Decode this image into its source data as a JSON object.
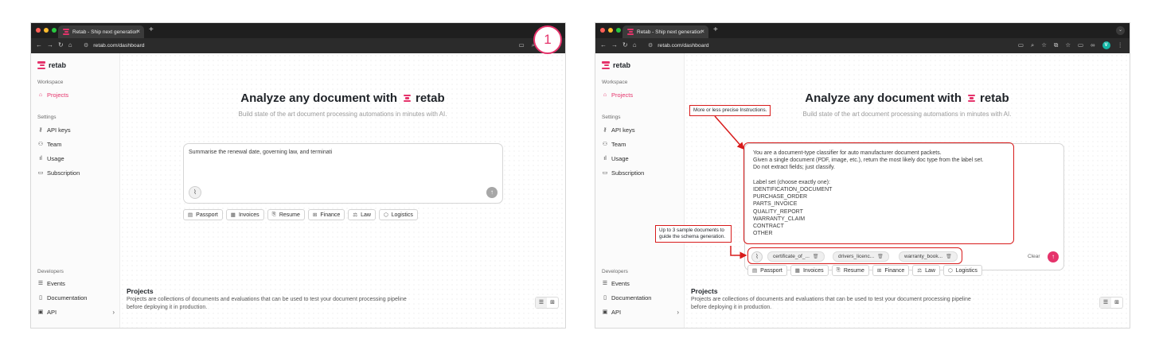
{
  "panels": [
    {
      "browser": {
        "tab_title": "Retab - Ship next generation",
        "tab_close": "×",
        "new_tab": "+",
        "url": "retab.com/dashboard"
      },
      "step_badge": "1",
      "sidebar": {
        "logo": "retab",
        "workspace_title": "Workspace",
        "workspace_items": [
          {
            "label": "Projects",
            "icon": "home-icon"
          }
        ],
        "settings_title": "Settings",
        "settings_items": [
          {
            "label": "API keys",
            "icon": "key-icon"
          },
          {
            "label": "Team",
            "icon": "team-icon"
          },
          {
            "label": "Usage",
            "icon": "bar-chart-icon"
          },
          {
            "label": "Subscription",
            "icon": "credit-card-icon"
          }
        ],
        "developers_title": "Developers",
        "developers_items": [
          {
            "label": "Events",
            "icon": "list-icon"
          },
          {
            "label": "Documentation",
            "icon": "book-icon"
          },
          {
            "label": "API",
            "icon": "terminal-icon"
          }
        ]
      },
      "main": {
        "headline": "Analyze any document with",
        "headline_brand": "retab",
        "subheadline": "Build state of the art document processing automations in minutes with AI.",
        "prompt_text": "Summarise the renewal date, governing law, and terminati",
        "suggestions": [
          "Passport",
          "Invoices",
          "Resume",
          "Finance",
          "Law",
          "Logistics"
        ],
        "projects_title": "Projects",
        "projects_desc": "Projects are collections of documents and evaluations that can be used to test your document processing pipeline before deploying it in production."
      }
    },
    {
      "browser": {
        "tab_title": "Retab - Ship next generation",
        "tab_close": "×",
        "new_tab": "+",
        "url": "retab.com/dashboard",
        "profile_initial": "V"
      },
      "sidebar": {
        "logo": "retab",
        "workspace_title": "Workspace",
        "workspace_items": [
          {
            "label": "Projects",
            "icon": "home-icon"
          }
        ],
        "settings_title": "Settings",
        "settings_items": [
          {
            "label": "API keys",
            "icon": "key-icon"
          },
          {
            "label": "Team",
            "icon": "team-icon"
          },
          {
            "label": "Usage",
            "icon": "bar-chart-icon"
          },
          {
            "label": "Subscription",
            "icon": "credit-card-icon"
          }
        ],
        "developers_title": "Developers",
        "developers_items": [
          {
            "label": "Events",
            "icon": "list-icon"
          },
          {
            "label": "Documentation",
            "icon": "book-icon"
          },
          {
            "label": "API",
            "icon": "terminal-icon"
          }
        ]
      },
      "main": {
        "headline": "Analyze any document with",
        "headline_brand": "retab",
        "subheadline": "Build state of the art document processing automations in minutes with AI.",
        "prompt_text": "You are a document-type classifier for auto manufacturer document packets.\nGiven a single document (PDF, image, etc.), return the most likely doc type from the label set.\nDo not extract fields; just classify.\n\nLabel set (choose exactly one):\nIDENTIFICATION_DOCUMENT\nPURCHASE_ORDER\nPARTS_INVOICE\nQUALITY_REPORT\nWARRANTY_CLAIM\nCONTRACT\nOTHER",
        "attachments": [
          "certificate_of_...",
          "drivers_licenc...",
          "warranty_book..."
        ],
        "clear_label": "Clear",
        "suggestions": [
          "Passport",
          "Invoices",
          "Resume",
          "Finance",
          "Law",
          "Logistics"
        ],
        "projects_title": "Projects",
        "projects_desc": "Projects are collections of documents and evaluations that can be used to test your document processing pipeline before deploying it in production."
      },
      "annotations": {
        "instructions_note": "More or less precise Instructions.",
        "samples_note": "Up to 3 sample documents to guide the schema generation."
      }
    }
  ],
  "colors": {
    "brand": "#e5336b",
    "annotation": "#d81b1b",
    "chrome_dark": "#1f1f1f"
  }
}
